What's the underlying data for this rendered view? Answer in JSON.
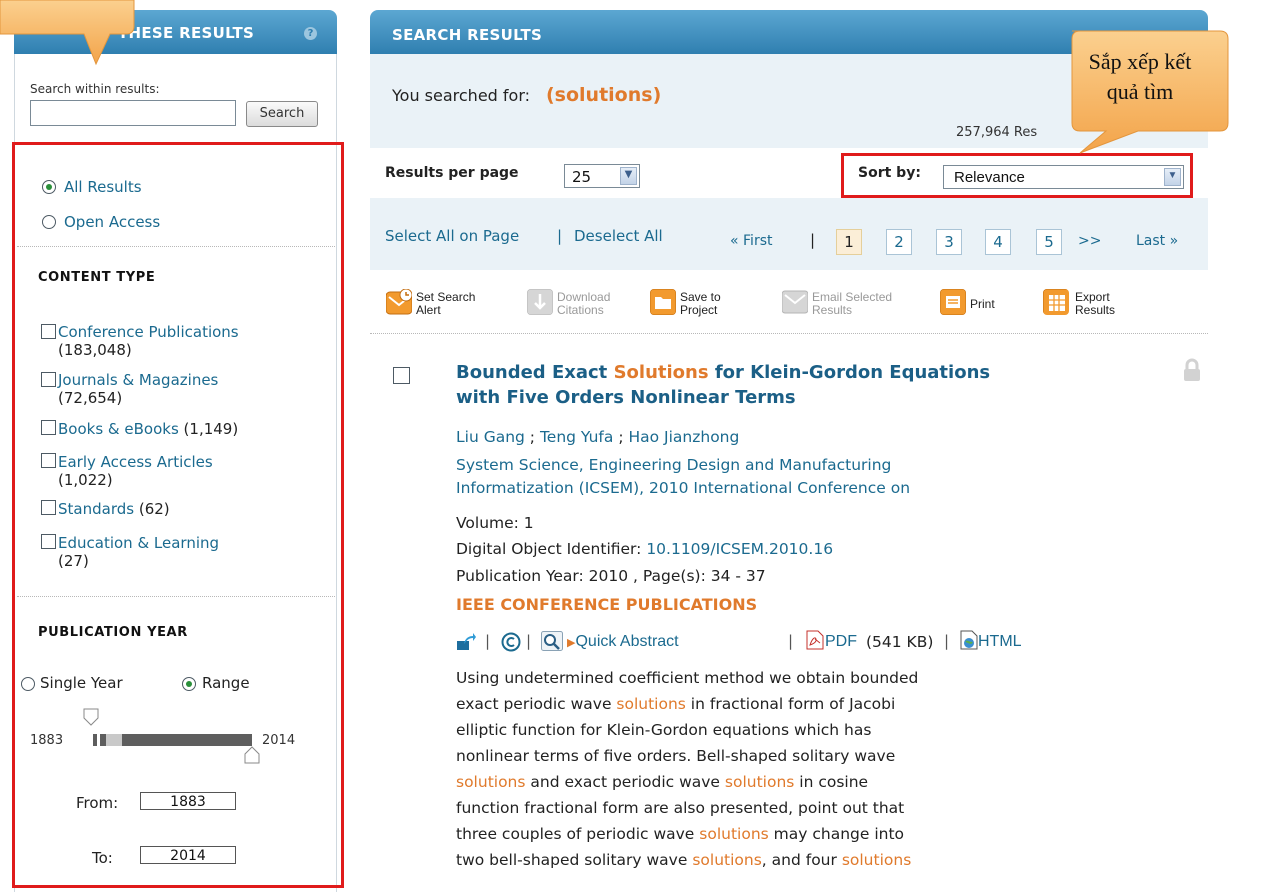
{
  "left_panel": {
    "header_title": "THESE RESULTS",
    "search_within_label": "Search within results:",
    "search_within_value": "",
    "search_button": "Search",
    "access": [
      {
        "label": "All Results",
        "selected": true
      },
      {
        "label": "Open Access",
        "selected": false
      }
    ],
    "content_type_title": "CONTENT TYPE",
    "content_types": [
      {
        "label": "Conference Publications",
        "count": "(183,048)"
      },
      {
        "label": "Journals & Magazines",
        "count": "(72,654)"
      },
      {
        "label": "Books & eBooks",
        "count": "(1,149)"
      },
      {
        "label": "Early Access Articles",
        "count": "(1,022)"
      },
      {
        "label": "Standards",
        "count": "(62)"
      },
      {
        "label": "Education & Learning",
        "count": "(27)"
      }
    ],
    "pub_year_title": "PUBLICATION YEAR",
    "year_mode": [
      {
        "label": "Single Year",
        "selected": false
      },
      {
        "label": "Range",
        "selected": true
      }
    ],
    "slider_min": "1883",
    "slider_max": "2014",
    "from_label": "From:",
    "from_value": "1883",
    "to_label": "To:",
    "to_value": "2014"
  },
  "main": {
    "header_title": "SEARCH RESULTS",
    "searched_for_label": "You searched for:",
    "searched_for_query": "(solutions)",
    "results_count": "257,964 Res",
    "results_per_page_label": "Results per page",
    "results_per_page_value": "25",
    "sort_by_label": "Sort by:",
    "sort_by_value": "Relevance",
    "select_all": "Select All on Page",
    "deselect_all": "Deselect All",
    "pagination": {
      "first": "« First",
      "pages": [
        "1",
        "2",
        "3",
        "4",
        "5"
      ],
      "current": "1",
      "next": ">>",
      "last": "Last »"
    },
    "toolbar": [
      {
        "icon": "alarm-mail-icon",
        "line1": "Set Search",
        "line2": "Alert",
        "enabled": true
      },
      {
        "icon": "download-icon",
        "line1": "Download",
        "line2": "Citations",
        "enabled": false
      },
      {
        "icon": "folder-icon",
        "line1": "Save to",
        "line2": "Project",
        "enabled": true
      },
      {
        "icon": "email-icon",
        "line1": "Email Selected",
        "line2": "Results",
        "enabled": false
      },
      {
        "icon": "print-icon",
        "line1": "Print",
        "line2": "",
        "enabled": true
      },
      {
        "icon": "export-icon",
        "line1": "Export",
        "line2": "Results",
        "enabled": true
      }
    ],
    "result": {
      "title_before": "Bounded Exact ",
      "title_highlight": "Solutions",
      "title_after_line1": " for Klein-Gordon Equations",
      "title_line2": "with Five Orders Nonlinear Terms",
      "authors": [
        "Liu Gang",
        "Teng Yufa",
        "Hao Jianzhong"
      ],
      "author_sep": " ; ",
      "venue_line1": "System Science, Engineering Design and Manufacturing",
      "venue_line2": "Informatization (ICSEM), 2010 International Conference on",
      "volume": "Volume: 1",
      "doi_label": "Digital Object Identifier: ",
      "doi_value": "10.1109/ICSEM.2010.16",
      "pub_year": "Publication Year: 2010 , Page(s): 34 - 37",
      "type": "IEEE CONFERENCE PUBLICATIONS",
      "quick_abstract": "Quick Abstract",
      "pdf_label": "PDF",
      "pdf_size": "(541 KB)",
      "html_label": "HTML",
      "abstract_lines": [
        [
          "Using undetermined coefficient method we obtain bounded"
        ],
        [
          "exact periodic wave ",
          {
            "hl": "solutions"
          },
          " in fractional form of Jacobi"
        ],
        [
          "elliptic function for Klein-Gordon equations which has"
        ],
        [
          "nonlinear terms of five orders. Bell-shaped solitary wave"
        ],
        [
          {
            "hl": "solutions"
          },
          " and exact periodic wave ",
          {
            "hl": "solutions"
          },
          " in cosine"
        ],
        [
          "function fractional form are also presented, point out that"
        ],
        [
          "three couples of periodic wave ",
          {
            "hl": "solutions"
          },
          " may change into"
        ],
        [
          "two bell-shaped solitary wave ",
          {
            "hl": "solutions"
          },
          ", and four ",
          {
            "hl": "solutions"
          }
        ]
      ]
    }
  },
  "callouts": {
    "sort_note_line1": "Sắp xếp kết",
    "sort_note_line2": "quả tìm"
  },
  "colors": {
    "header_blue": "#2f7fb0",
    "link_blue": "#1b6a8f",
    "highlight_orange": "#e07a2c",
    "annotation_red": "#e01b1b",
    "callout_orange": "#f3a44a"
  }
}
